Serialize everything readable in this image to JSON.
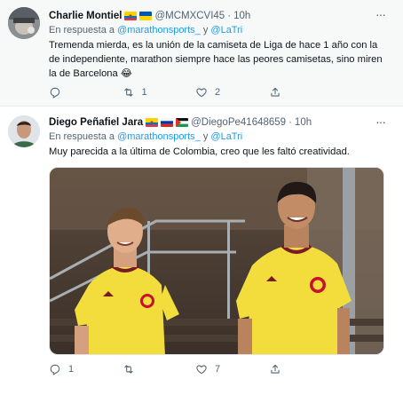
{
  "tweets": [
    {
      "author_name": "Charlie Montiel",
      "flags": [
        "ecuador-flag",
        "ukraine-flag"
      ],
      "handle": "@MCMXCVI45",
      "separator": "·",
      "time": "10h",
      "more": "···",
      "reply_prefix": "En respuesta a",
      "reply_mention_1": "@marathonsports_",
      "reply_and": "y",
      "reply_mention_2": "@LaTri",
      "text": "Tremenda mierda, es la unión de la camiseta de Liga de hace 1 año con la de independiente, marathon siempre hace las peores camisetas, sino miren la de Barcelona 😂",
      "actions": {
        "replies": "",
        "retweets": "1",
        "likes": "2"
      }
    },
    {
      "author_name": "Diego Peñafiel Jara",
      "flags": [
        "ecuador-flag",
        "russia-flag",
        "palestine-flag"
      ],
      "handle": "@DiegoPe41648659",
      "separator": "·",
      "time": "10h",
      "more": "···",
      "reply_prefix": "En respuesta a",
      "reply_mention_1": "@marathonsports_",
      "reply_and": "y",
      "reply_mention_2": "@LaTri",
      "text": "Muy parecida a la última de Colombia, creo que les faltó creatividad.",
      "media": "photo-two-players-yellow-colombia-jerseys",
      "actions": {
        "replies": "1",
        "retweets": "",
        "likes": "7"
      }
    }
  ],
  "colors": {
    "link": "#1d9bf0",
    "muted": "#536471",
    "text": "#0f1419",
    "jersey": "#f3dd3c"
  }
}
